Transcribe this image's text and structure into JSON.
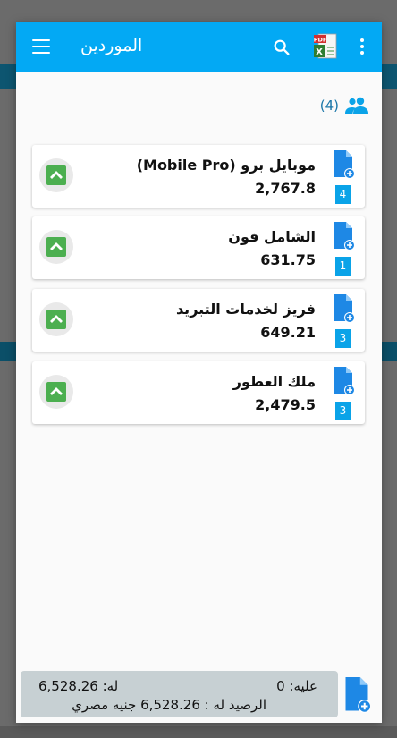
{
  "header": {
    "title": "الموردين",
    "menu_icon": "menu-icon",
    "search_icon": "search-icon",
    "export_icon": "pdf-excel-export-icon",
    "more_icon": "more-vertical-icon"
  },
  "suppliers_count": "(4)",
  "suppliers": [
    {
      "name": "موبايل برو (Mobile Pro)",
      "amount": "2,767.8",
      "count": "4"
    },
    {
      "name": "الشامل فون",
      "amount": "631.75",
      "count": "1"
    },
    {
      "name": "فريز لخدمات التبريد",
      "amount": "649.21",
      "count": "3"
    },
    {
      "name": "ملك العطور",
      "amount": "2,479.5",
      "count": "3"
    }
  ],
  "summary": {
    "on_label": "عليه: 0",
    "for_label": "له: 6,528.26",
    "balance": "الرصيد له : 6,528.26 جنيه مصري"
  },
  "colors": {
    "primary": "#03a9f4",
    "accent_green": "#4caf50",
    "doc_blue": "#1e88e5",
    "badge_blue": "#0aa3e8"
  }
}
